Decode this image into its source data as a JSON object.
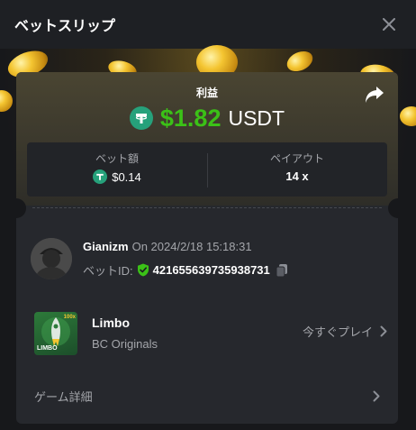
{
  "header": {
    "title": "ベットスリップ",
    "close_icon": "close-icon"
  },
  "profit": {
    "label": "利益",
    "amount": "$1.82",
    "currency": "USDT",
    "amount_color": "#3bc117"
  },
  "stats": {
    "bet_amount_label": "ベット額",
    "bet_amount_value": "$0.14",
    "payout_label": "ペイアウト",
    "payout_value": "14 x"
  },
  "user": {
    "name": "Gianizm",
    "on_text": "On 2024/2/18 15:18:31",
    "bet_id_label": "ベットID:",
    "bet_id": "421655639735938731"
  },
  "game": {
    "name": "Limbo",
    "provider": "BC Originals",
    "play_label": "今すぐプレイ",
    "thumb_text": "LIMBO",
    "thumb_badge": "100x"
  },
  "details": {
    "label": "ゲーム詳細"
  },
  "colors": {
    "background": "#17181b",
    "card": "#26282d",
    "accent_green": "#3bc117",
    "tether": "#26a17b"
  }
}
